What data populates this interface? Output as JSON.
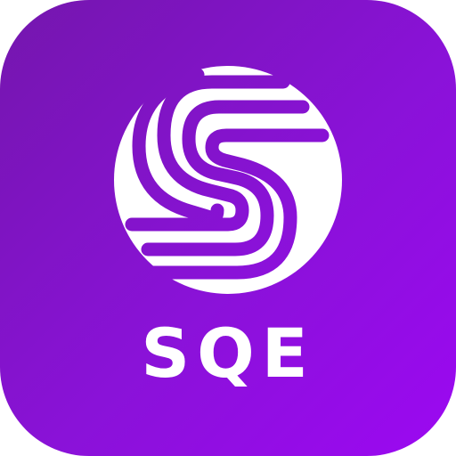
{
  "app_icon": {
    "brand_name": "SQE",
    "logo_icon": "striped-s-sphere-icon",
    "colors": {
      "gradient_start": "#7416ad",
      "gradient_end": "#9c08f2",
      "foreground": "#ffffff"
    }
  }
}
